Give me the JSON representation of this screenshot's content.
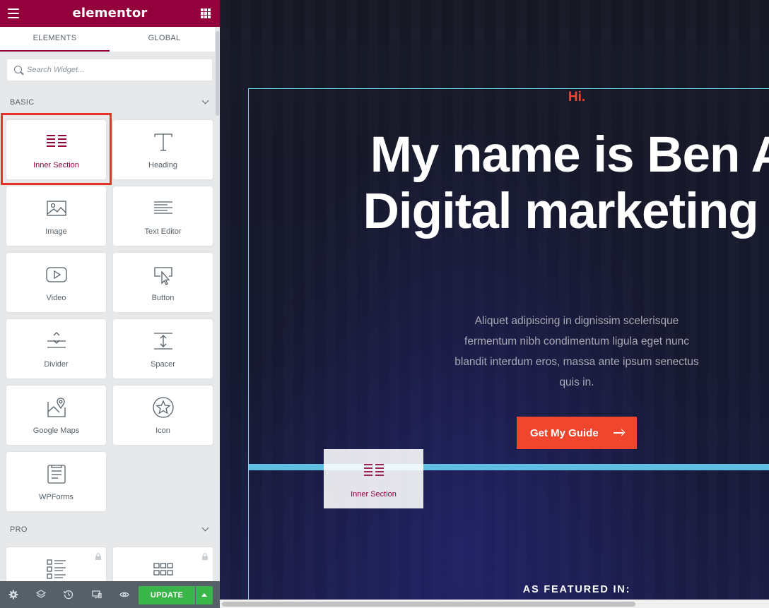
{
  "app": {
    "logo": "elementor"
  },
  "colors": {
    "brand": "#93003c",
    "accent_red": "#f0462d",
    "update_green": "#39b54a",
    "drop_line": "#61bde2"
  },
  "tabs": [
    {
      "label": "ELEMENTS",
      "active": true
    },
    {
      "label": "GLOBAL",
      "active": false
    }
  ],
  "search": {
    "placeholder": "Search Widget..."
  },
  "categories": {
    "basic": {
      "title": "BASIC"
    },
    "pro": {
      "title": "PRO"
    }
  },
  "widgets": {
    "inner_section": {
      "label": "Inner Section",
      "icon": "inner-section-icon"
    },
    "heading": {
      "label": "Heading",
      "icon": "heading-icon"
    },
    "image": {
      "label": "Image",
      "icon": "image-icon"
    },
    "text_editor": {
      "label": "Text Editor",
      "icon": "text-editor-icon"
    },
    "video": {
      "label": "Video",
      "icon": "video-icon"
    },
    "button": {
      "label": "Button",
      "icon": "button-icon"
    },
    "divider": {
      "label": "Divider",
      "icon": "divider-icon"
    },
    "spacer": {
      "label": "Spacer",
      "icon": "spacer-icon"
    },
    "google_maps": {
      "label": "Google Maps",
      "icon": "google-maps-icon"
    },
    "icon": {
      "label": "Icon",
      "icon": "star-icon"
    },
    "wpforms": {
      "label": "WPForms",
      "icon": "wpforms-icon"
    }
  },
  "footer": {
    "update_label": "UPDATE"
  },
  "preview": {
    "hi": "Hi.",
    "headline": "My name is Ben Arthur. Digital marketing expert",
    "subtext": "Aliquet adipiscing in dignissim scelerisque fermentum nibh condimentum ligula eget nunc blandit interdum eros, massa ante ipsum senectus quis in.",
    "cta_label": "Get My Guide",
    "featured": "AS FEATURED IN:"
  },
  "drag_ghost": {
    "label": "Inner Section"
  }
}
